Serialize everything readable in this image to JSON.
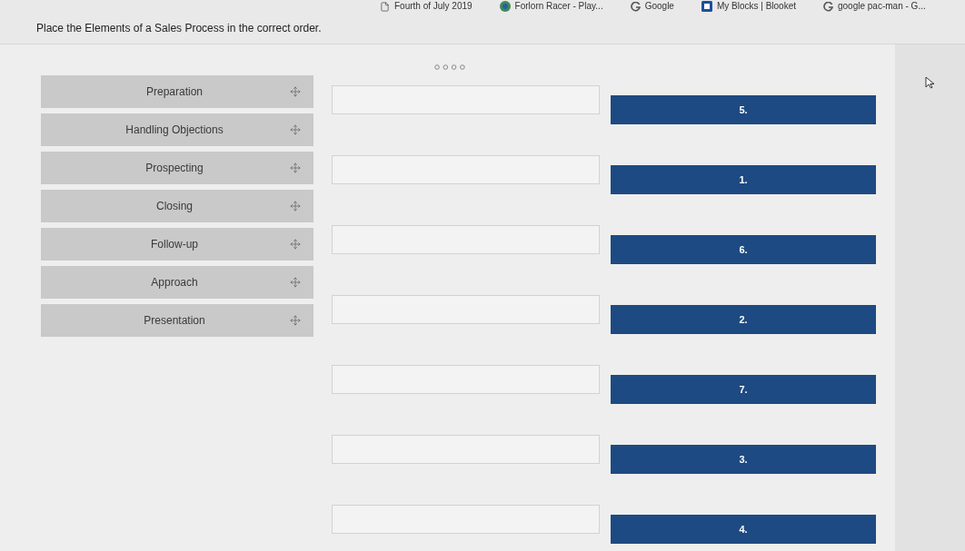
{
  "bookmarks_bar": {
    "items": [
      {
        "kind": "page",
        "label": "Fourth of July 2019"
      },
      {
        "kind": "game",
        "label": "Forlorn Racer - Play..."
      },
      {
        "kind": "google",
        "label": "Google"
      },
      {
        "kind": "blooket",
        "label": "My Blocks | Blooket"
      },
      {
        "kind": "google",
        "label": "google pac-man - G..."
      }
    ]
  },
  "question": {
    "prompt": "Place the Elements of a Sales Process in the correct order."
  },
  "draggable_items": [
    {
      "label": "Preparation"
    },
    {
      "label": "Handling Objections"
    },
    {
      "label": "Prospecting"
    },
    {
      "label": "Closing"
    },
    {
      "label": "Follow-up"
    },
    {
      "label": "Approach"
    },
    {
      "label": "Presentation"
    }
  ],
  "answer_rows": [
    {
      "number": "5."
    },
    {
      "number": "1."
    },
    {
      "number": "6."
    },
    {
      "number": "2."
    },
    {
      "number": "7."
    },
    {
      "number": "3."
    },
    {
      "number": "4."
    }
  ]
}
